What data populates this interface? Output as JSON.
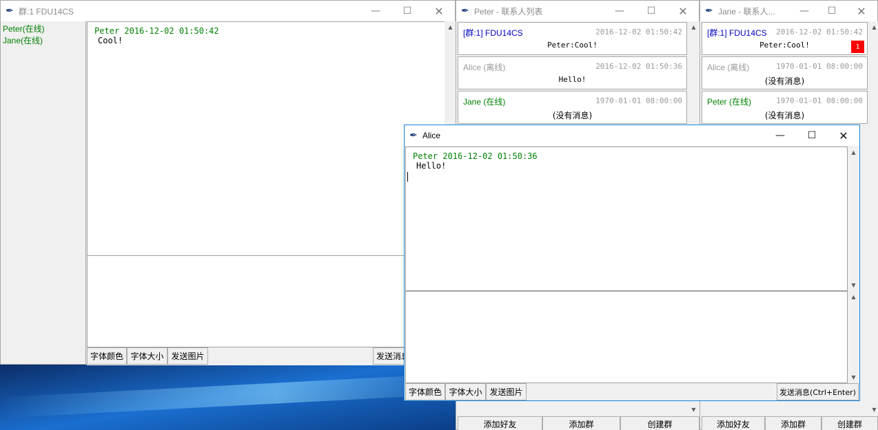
{
  "group_window": {
    "title": "群:1 FDU14CS",
    "members": [
      "Peter(在线)",
      "Jane(在线)"
    ],
    "messages": [
      {
        "header": "Peter  2016-12-02 01:50:42",
        "text": "Cool!"
      }
    ],
    "font_color_label": "字体颜色",
    "font_size_label": "字体大小",
    "send_image_label": "发送图片",
    "send_label": "发送消息"
  },
  "peter_list": {
    "title": "Peter - 联系人列表",
    "contacts": [
      {
        "name": "[群:1] FDU14CS",
        "time": "2016-12-02 01:50:42",
        "preview": "Peter:Cool!"
      },
      {
        "name": "Alice (离线)",
        "time": "2016-12-02 01:50:36",
        "preview": "Hello!"
      },
      {
        "name": "Jane (在线)",
        "time": "1970-01-01 08:00:00",
        "preview": "(没有消息)"
      }
    ],
    "add_friend_label": "添加好友",
    "add_group_label": "添加群",
    "create_group_label": "创建群"
  },
  "jane_list": {
    "title": "Jane - 联系人...",
    "contacts": [
      {
        "name": "[群:1] FDU14CS",
        "time": "2016-12-02 01:50:42",
        "preview": "Peter:Cool!",
        "badge": "1"
      },
      {
        "name": "Alice (离线)",
        "time": "1970-01-01 08:00:00",
        "preview": "(没有消息)"
      },
      {
        "name": "Peter (在线)",
        "time": "1970-01-01 08:00:00",
        "preview": "(没有消息)"
      }
    ],
    "add_friend_label": "添加好友",
    "add_group_label": "添加群",
    "create_group_label": "创建群"
  },
  "alice_window": {
    "title": "Alice",
    "messages": [
      {
        "header": "Peter  2016-12-02 01:50:36",
        "text": "Hello!"
      }
    ],
    "font_color_label": "字体颜色",
    "font_size_label": "字体大小",
    "send_image_label": "发送图片",
    "send_label": "发送消息(Ctrl+Enter)"
  },
  "icons": {
    "app": "feather-icon",
    "minimize": "minimize-icon",
    "maximize": "maximize-icon",
    "close": "close-icon"
  },
  "colors": {
    "online": "#008000",
    "group": "#0000c0",
    "offline": "#999999",
    "badge": "#ff0000",
    "active_border": "#1883d7"
  }
}
